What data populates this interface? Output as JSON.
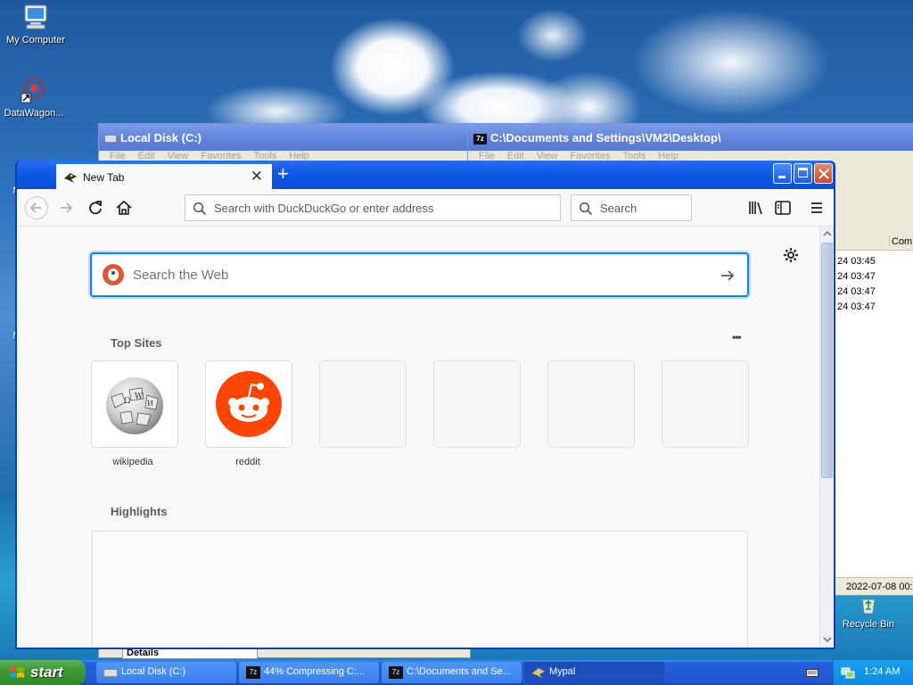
{
  "desktop": {
    "icons": [
      {
        "label": "My Computer"
      },
      {
        "label": "DataWagon..."
      },
      {
        "label": "Mic"
      },
      {
        "label": "Mic"
      },
      {
        "label": "Recycle Bin"
      }
    ]
  },
  "back_windows": {
    "local_disk": {
      "title": "Local Disk (C:)",
      "menu": [
        "File",
        "Edit",
        "View",
        "Favorites",
        "Tools",
        "Help"
      ],
      "view_select": "Details"
    },
    "sevenzip": {
      "title": "C:\\Documents and Settings\\VM2\\Desktop\\",
      "menu": [
        "File",
        "Edit",
        "View",
        "Favorites",
        "Tools",
        "Help"
      ],
      "column_header": "Comm",
      "rows": [
        "24 03:45",
        "24 03:47",
        "24 03:47",
        "24 03:47"
      ],
      "status_date": "2022-07-08 00:"
    }
  },
  "browser": {
    "tab_title": "New Tab",
    "address_placeholder": "Search with DuckDuckGo or enter address",
    "search_placeholder": "Search",
    "web_search_placeholder": "Search the Web",
    "top_sites_heading": "Top Sites",
    "top_sites": [
      {
        "label": "wikipedia"
      },
      {
        "label": "reddit"
      },
      {
        "label": ""
      },
      {
        "label": ""
      },
      {
        "label": ""
      },
      {
        "label": ""
      }
    ],
    "highlights_heading": "Highlights",
    "more_menu": "•••"
  },
  "taskbar": {
    "start_label": "start",
    "buttons": [
      {
        "label": "Local Disk (C:)"
      },
      {
        "label": "44% Compressing C:..."
      },
      {
        "label": "C:\\Documents and Se..."
      },
      {
        "label": "Mypal"
      }
    ],
    "clock": "1:24 AM"
  },
  "colors": {
    "accent": "#0a84ff",
    "xp_blue": "#0a4fd8",
    "reddit_orange": "#ff4500",
    "start_green": "#3c9a34"
  }
}
